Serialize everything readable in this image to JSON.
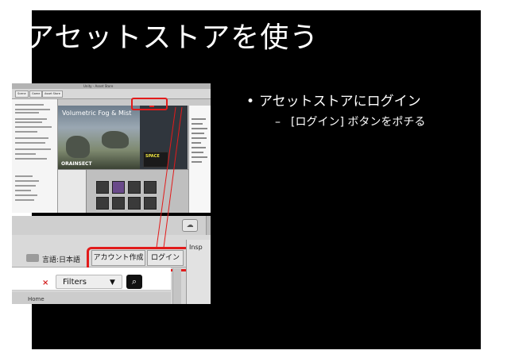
{
  "slide": {
    "title": "アセットストアを使う",
    "bullet": "アセットストアにログイン",
    "bullet_marker": "•",
    "sub_bullet": "[ログイン] ボタンをポチる",
    "sub_marker": "–"
  },
  "screenshot_top": {
    "window_title": "Unity - Asset Store",
    "tabs": [
      "Scene",
      "Game",
      "Asset Store"
    ],
    "banner_title": "Volumetric Fog & Mist",
    "banner_logo": "ORAINSECT",
    "game_banner": "SPACE"
  },
  "screenshot_bottom": {
    "lang_label": "言語:日本語",
    "create_account_label": "アカウント作成",
    "login_label": "ログイン",
    "clear_label": "×",
    "filters_label": "Filters",
    "dropdown_caret": "▼",
    "search_glyph": "⌕",
    "inspector_label": "Insp",
    "cloud_glyph": "☁",
    "category_label": "Home"
  },
  "colors": {
    "slide_bg": "#000000",
    "highlight": "#e21b1b",
    "text": "#ffffff"
  }
}
